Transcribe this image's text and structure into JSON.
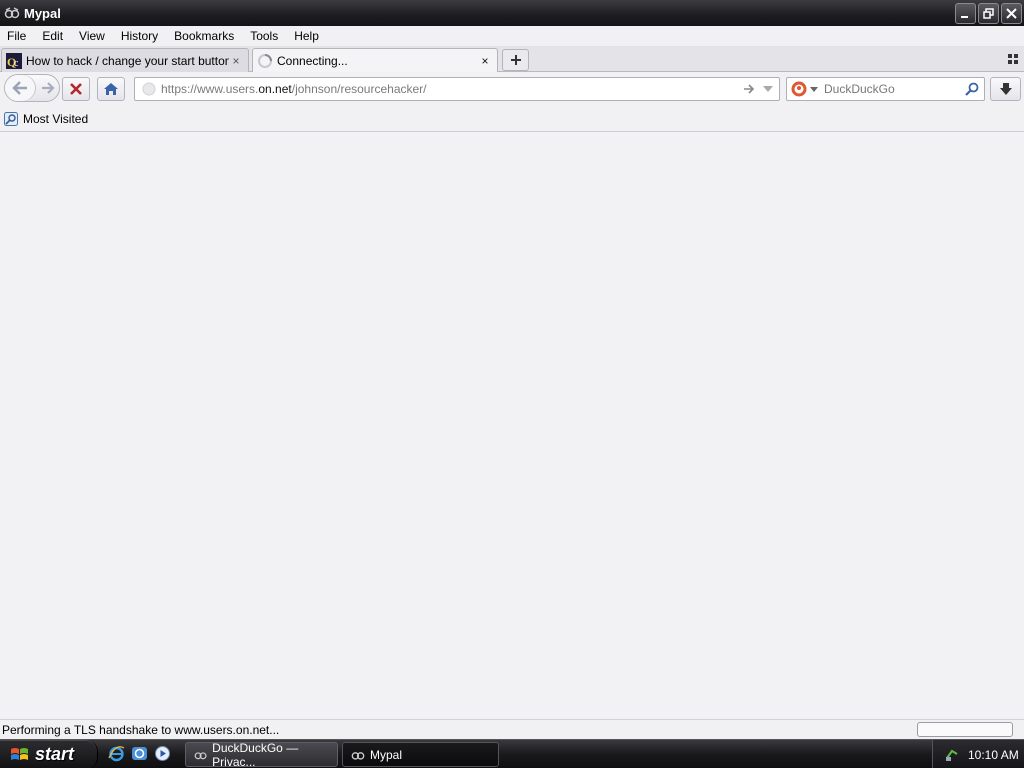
{
  "window": {
    "title": "Mypal"
  },
  "menu": [
    "File",
    "Edit",
    "View",
    "History",
    "Bookmarks",
    "Tools",
    "Help"
  ],
  "tabs": [
    {
      "label": "How to hack / change your start button i...",
      "close": "×"
    },
    {
      "label": "Connecting...",
      "close": "×"
    }
  ],
  "new_tab_label": "+",
  "urlbar": {
    "prefix": "https://www.users.",
    "domain": "on.net",
    "path": "/johnson/resourcehacker/"
  },
  "search": {
    "placeholder": "DuckDuckGo"
  },
  "bookmarks": [
    {
      "label": "Most Visited",
      "icon": "most-visited-icon"
    }
  ],
  "status": {
    "text": "Performing a TLS handshake to www.users.on.net...",
    "progress": 0
  },
  "taskbar": {
    "start_label": "start",
    "tasks": [
      {
        "label": "DuckDuckGo — Privac..."
      },
      {
        "label": "Mypal"
      }
    ],
    "clock": "10:10 AM"
  },
  "colors": {
    "accent": "#3b63a8",
    "stop": "#b3262c",
    "titlebar": "#1d1d21"
  }
}
